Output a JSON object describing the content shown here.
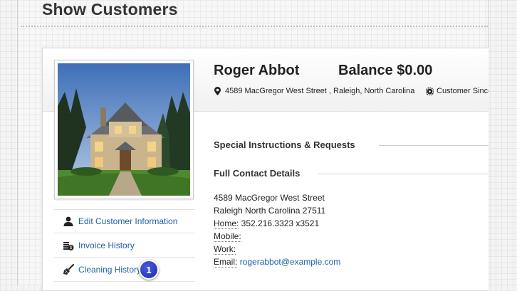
{
  "page": {
    "title": "Show Customers"
  },
  "customer": {
    "name": "Roger Abbot",
    "balance": "Balance $0.00",
    "address_line": "4589 MacGregor West Street , Raleigh, North Carolina",
    "since": "Customer Since"
  },
  "sections": {
    "special": "Special Instructions & Requests",
    "contact": "Full Contact Details"
  },
  "contact": {
    "street": "4589 MacGregor West Street",
    "city_line": "Raleigh North Carolina 27511",
    "home_label": "Home:",
    "home_value": " 352.216.3323 x3521",
    "mobile_label": "Mobile:",
    "work_label": "Work:",
    "email_label": "Email:",
    "email_value": "rogerabbot@example.com"
  },
  "side_nav": [
    {
      "label": "Edit Customer Information",
      "icon": "user-icon"
    },
    {
      "label": "Invoice History",
      "icon": "coins-icon"
    },
    {
      "label": "Cleaning History",
      "icon": "broom-icon"
    }
  ],
  "callout": {
    "number": "1"
  },
  "colors": {
    "link": "#1f5fa8",
    "badge": "#2a3bc4"
  }
}
